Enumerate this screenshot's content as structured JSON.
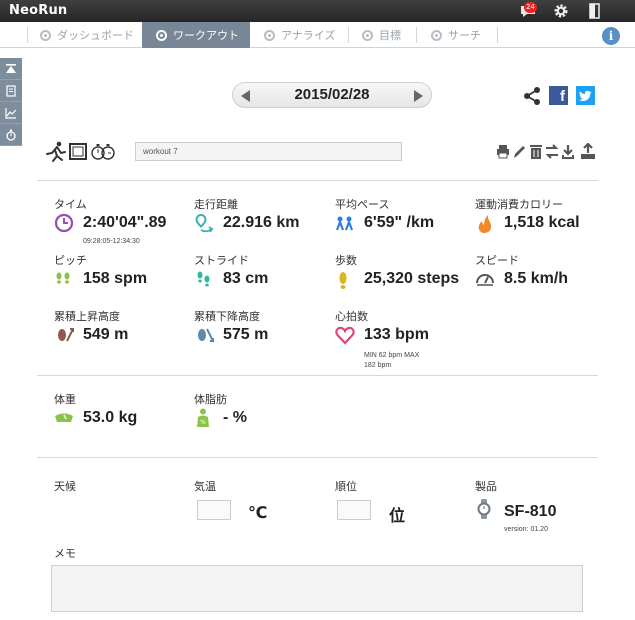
{
  "app": {
    "logo": "NeoRun",
    "notification_count": "24"
  },
  "tabs": [
    {
      "label": "ダッシュボード",
      "active": false
    },
    {
      "label": "ワークアウト",
      "active": true
    },
    {
      "label": "アナライズ",
      "active": false
    },
    {
      "label": "目標",
      "active": false
    },
    {
      "label": "サーチ",
      "active": false
    }
  ],
  "info_label": "i",
  "date_nav": {
    "date": "2015/02/28"
  },
  "workout": {
    "name": "workout 7"
  },
  "metrics": {
    "time": {
      "label": "タイム",
      "value": "2:40'04\".89",
      "sub": "09:28:05-12:34:30"
    },
    "distance": {
      "label": "走行距離",
      "value": "22.916 km"
    },
    "pace": {
      "label": "平均ペース",
      "value": "6'59\" /km"
    },
    "calories": {
      "label": "運動消費カロリー",
      "value": "1,518 kcal"
    },
    "pitch": {
      "label": "ピッチ",
      "value": "158 spm"
    },
    "stride": {
      "label": "ストライド",
      "value": "83 cm"
    },
    "steps": {
      "label": "歩数",
      "value": "25,320 steps"
    },
    "speed": {
      "label": "スピード",
      "value": "8.5 km/h"
    },
    "ascent": {
      "label": "累積上昇高度",
      "value": "549 m"
    },
    "descent": {
      "label": "累積下降高度",
      "value": "575 m"
    },
    "heart_rate": {
      "label": "心拍数",
      "value": "133 bpm",
      "sub": "MIN 62 bpm MAX",
      "sub2": "182 bpm"
    }
  },
  "body": {
    "weight": {
      "label": "体重",
      "value": "53.0 kg"
    },
    "body_fat": {
      "label": "体脂肪",
      "value": "- %"
    }
  },
  "conditions": {
    "weather": {
      "label": "天候"
    },
    "temperature": {
      "label": "気温",
      "unit": "℃"
    },
    "rank": {
      "label": "順位",
      "unit": "位"
    },
    "product": {
      "label": "製品",
      "value": "SF-810",
      "version": "version: 01.20"
    }
  },
  "memo": {
    "label": "メモ",
    "value": ""
  },
  "colors": {
    "topbar": "#2e2e2e",
    "tab_active": "#778797",
    "sidebar": "#7d8d9c",
    "purple": "#9b4fb5",
    "teal": "#3ab0b4",
    "blue": "#2e7fd8",
    "orange": "#f08a2c",
    "green": "#8bc34a",
    "gold": "#d9b51f",
    "brown": "#8a5a4a",
    "steel": "#5e8aa8",
    "pink": "#e0457b"
  },
  "icons": {
    "topbar": [
      "comment-icon",
      "gear-icon",
      "logout-door-icon"
    ],
    "sidebar": [
      "scroll-top-icon",
      "memo-icon",
      "chart-icon",
      "stopwatch-icon"
    ],
    "activity": [
      "running-icon",
      "treadmill-screen-icon",
      "lap-watch-icon"
    ],
    "actions": [
      "print-icon",
      "edit-icon",
      "delete-icon",
      "transfer-icon",
      "download-icon",
      "upload-icon"
    ],
    "share": [
      "share-icon",
      "facebook-icon",
      "twitter-icon"
    ]
  }
}
